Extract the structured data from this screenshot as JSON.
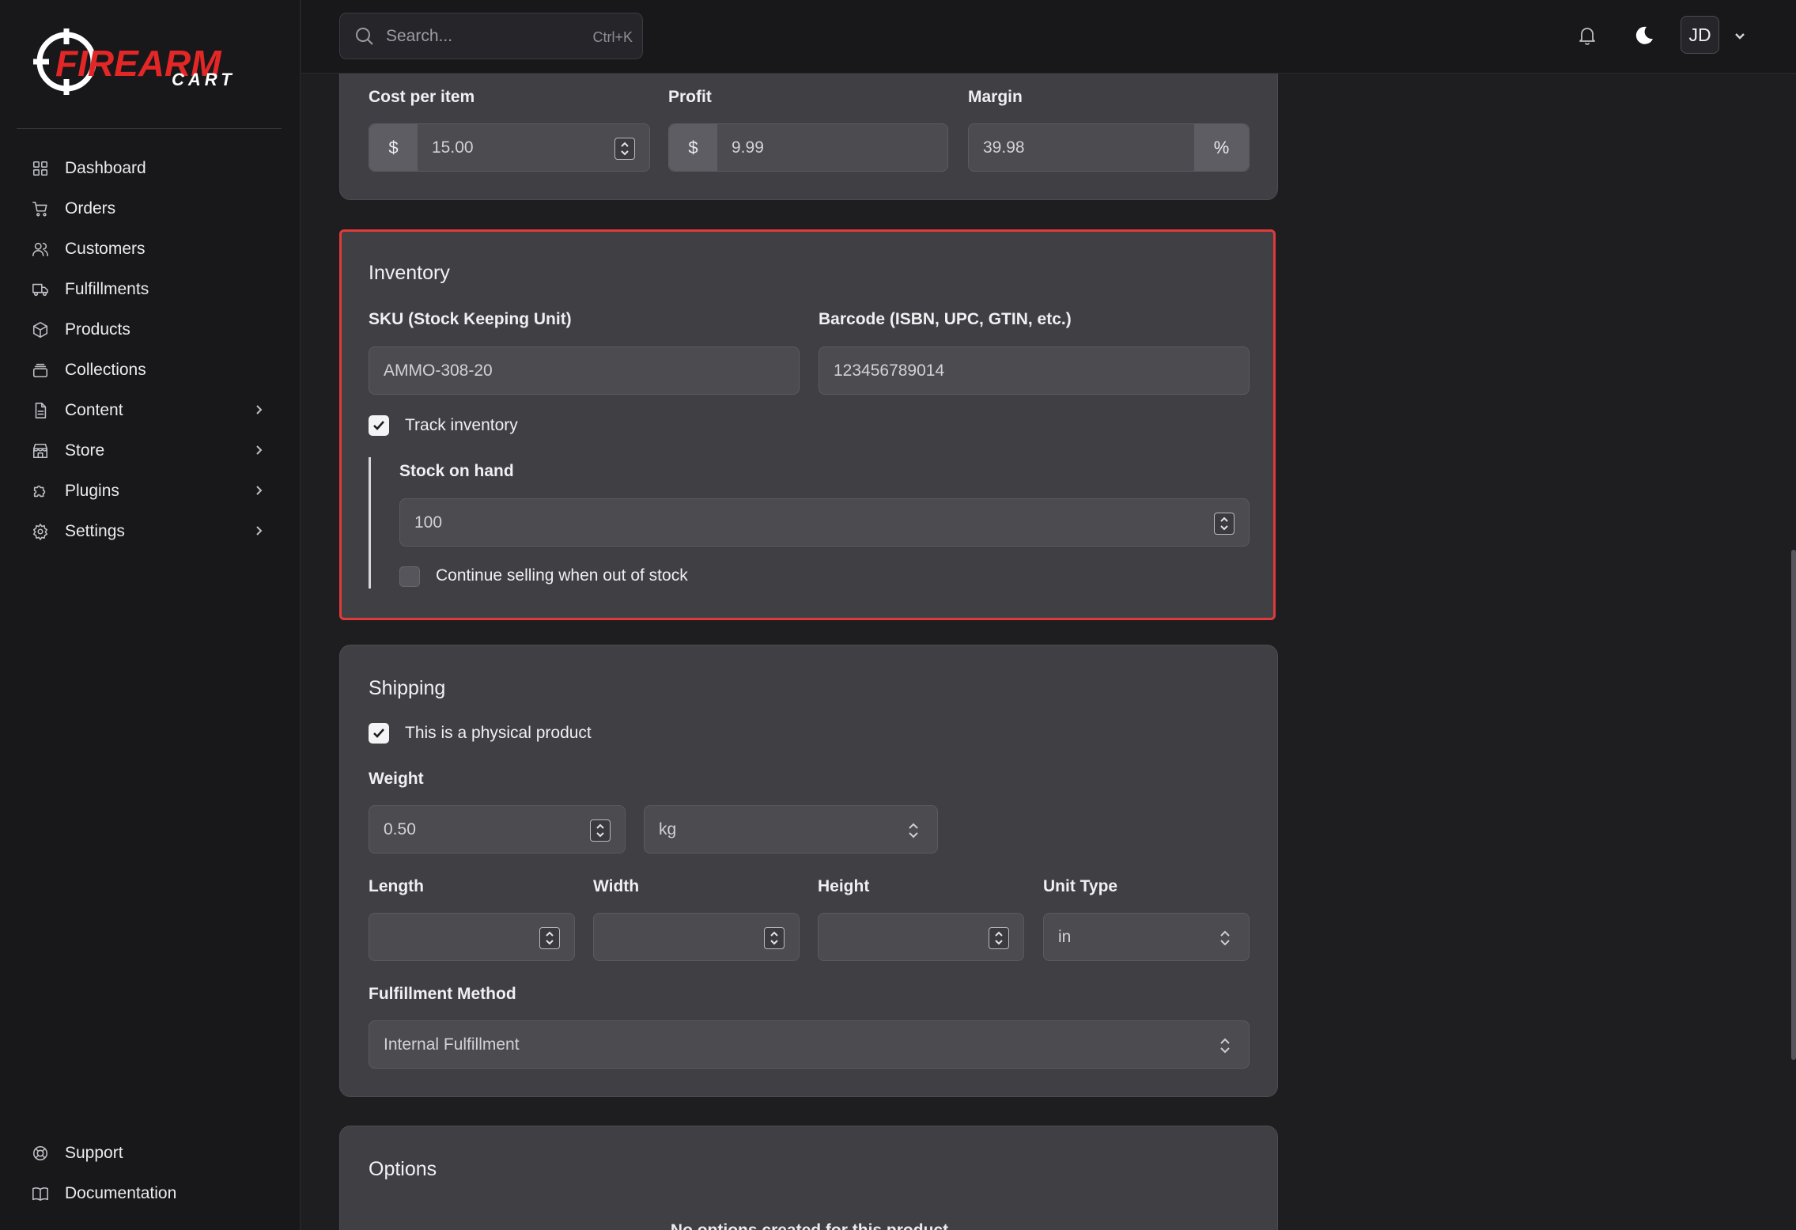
{
  "app": {
    "logo_text_top": "FIREARM",
    "logo_text_bottom": "CART"
  },
  "search": {
    "placeholder": "Search...",
    "shortcut": "Ctrl+K"
  },
  "user": {
    "initials": "JD"
  },
  "sidebar": {
    "items": [
      {
        "label": "Dashboard",
        "icon": "grid-icon",
        "has_children": false
      },
      {
        "label": "Orders",
        "icon": "cart-icon",
        "has_children": false
      },
      {
        "label": "Customers",
        "icon": "users-icon",
        "has_children": false
      },
      {
        "label": "Fulfillments",
        "icon": "truck-icon",
        "has_children": false
      },
      {
        "label": "Products",
        "icon": "box-icon",
        "has_children": false
      },
      {
        "label": "Collections",
        "icon": "stack-icon",
        "has_children": false
      },
      {
        "label": "Content",
        "icon": "file-icon",
        "has_children": true
      },
      {
        "label": "Store",
        "icon": "store-icon",
        "has_children": true
      },
      {
        "label": "Plugins",
        "icon": "puzzle-icon",
        "has_children": true
      },
      {
        "label": "Settings",
        "icon": "gear-icon",
        "has_children": true
      }
    ],
    "bottom_items": [
      {
        "label": "Support",
        "icon": "lifebuoy-icon"
      },
      {
        "label": "Documentation",
        "icon": "book-icon"
      }
    ]
  },
  "pricing": {
    "cost_label": "Cost per item",
    "cost_prefix": "$",
    "cost_value": "15.00",
    "profit_label": "Profit",
    "profit_prefix": "$",
    "profit_value": "9.99",
    "margin_label": "Margin",
    "margin_value": "39.98",
    "margin_suffix": "%"
  },
  "inventory": {
    "title": "Inventory",
    "sku_label": "SKU (Stock Keeping Unit)",
    "sku_value": "AMMO-308-20",
    "barcode_label": "Barcode (ISBN, UPC, GTIN, etc.)",
    "barcode_value": "123456789014",
    "track_label": "Track inventory",
    "track_checked": true,
    "stock_label": "Stock on hand",
    "stock_value": "100",
    "continue_label": "Continue selling when out of stock",
    "continue_checked": false
  },
  "shipping": {
    "title": "Shipping",
    "physical_label": "This is a physical product",
    "physical_checked": true,
    "weight_label": "Weight",
    "weight_value": "0.50",
    "weight_unit": "kg",
    "length_label": "Length",
    "length_value": "",
    "width_label": "Width",
    "width_value": "",
    "height_label": "Height",
    "height_value": "",
    "unit_type_label": "Unit Type",
    "unit_type_value": "in",
    "fulfillment_label": "Fulfillment Method",
    "fulfillment_value": "Internal Fulfillment"
  },
  "options": {
    "title": "Options",
    "empty_text": "No options created for this product"
  },
  "colors": {
    "accent_red": "#e03a3a",
    "background": "#1e1e21",
    "card": "#3f3f44"
  }
}
